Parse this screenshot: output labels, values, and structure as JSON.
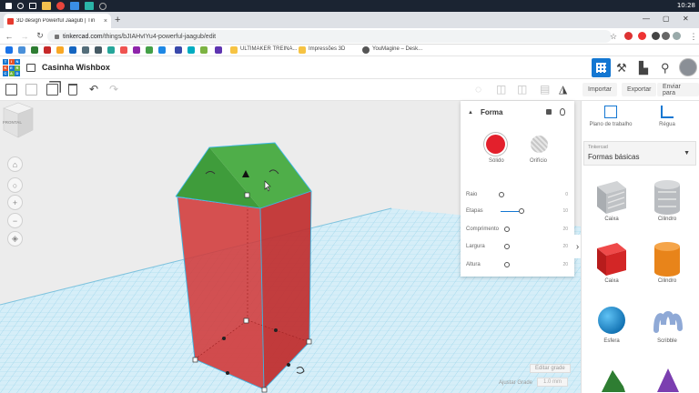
{
  "taskbar": {
    "clock": "10:28"
  },
  "browser": {
    "tab_title": "3D design Powerful Jaagub | Tin",
    "tab_close": "×",
    "new_tab": "+",
    "url_host": "tinkercad.com",
    "url_path": "/things/bJIAHvIYu4-powerful-jaagub/edit",
    "bookmarks": [
      {
        "label": "ULTIMAKER TREINA..."
      },
      {
        "label": "Impressões 3D"
      },
      {
        "label": "YouMagine – Desk..."
      }
    ]
  },
  "tinkercad": {
    "design_title": "Casinha Wishbox",
    "logo_letters": [
      "T",
      "I",
      "N",
      "K",
      "E",
      "R",
      "C",
      "A",
      "D"
    ],
    "actions": {
      "import": "Importar",
      "export": "Exportar",
      "send": "Enviar para"
    }
  },
  "inspector": {
    "title": "Forma",
    "solid_label": "Sólido",
    "hole_label": "Orifício",
    "solid_color": "#e3202c",
    "params": [
      {
        "label": "Raio",
        "value": "0"
      },
      {
        "label": "Etapas",
        "value": "10"
      },
      {
        "label": "Comprimento",
        "value": "20"
      },
      {
        "label": "Largura",
        "value": "20"
      },
      {
        "label": "Altura",
        "value": "20"
      }
    ]
  },
  "viewcube": {
    "face": "FRONTAL"
  },
  "grid": {
    "edit_label": "Editar grade",
    "snap_label": "Ajustar Grade",
    "snap_value": "1.0 mm"
  },
  "rpanel": {
    "workplane_label": "Plano de trabalho",
    "ruler_label": "Régua",
    "library_small": "Tinkercad",
    "library_name": "Formas básicas",
    "shapes": [
      {
        "label": "Caixa",
        "color": "#b9bcc0"
      },
      {
        "label": "Cilindro",
        "color": "#b9bcc0"
      },
      {
        "label": "Caixa",
        "color": "#e3202c"
      },
      {
        "label": "Cilindro",
        "color": "#e8841a"
      },
      {
        "label": "Esfera",
        "color": "#1d8fd8"
      },
      {
        "label": "Scribble",
        "color": "#8fa9d6"
      }
    ]
  },
  "colors": {
    "accent": "#1477d2",
    "roof": "#3f9c3b",
    "box": "#d23a3a"
  }
}
